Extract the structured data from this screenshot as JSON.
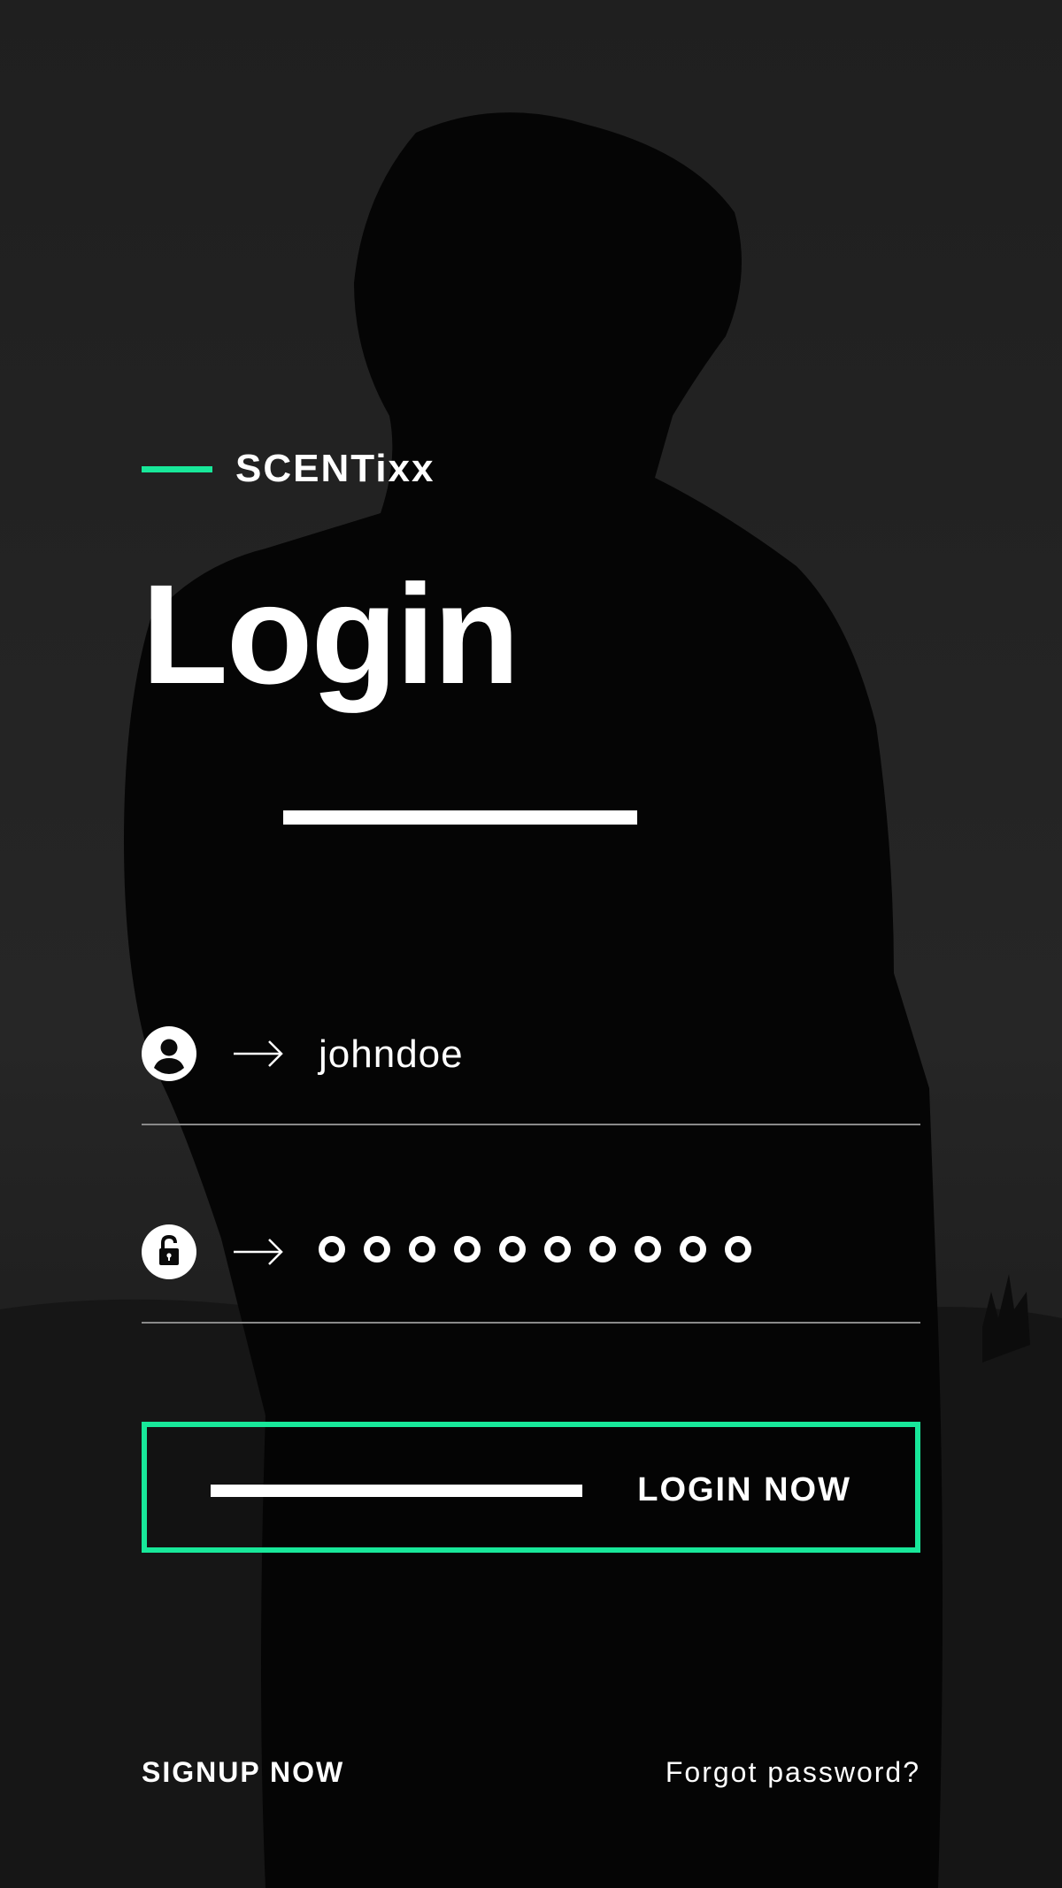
{
  "brand": {
    "name": "SCENTixx",
    "accent_color": "#18e89a"
  },
  "page": {
    "title": "Login"
  },
  "username_field": {
    "icon": "user-icon",
    "value": "johndoe"
  },
  "password_field": {
    "icon": "lock-icon",
    "masked_length": 10
  },
  "login_button": {
    "label": "LOGIN NOW"
  },
  "footer": {
    "signup_label": "SIGNUP NOW",
    "forgot_label": "Forgot password?"
  }
}
